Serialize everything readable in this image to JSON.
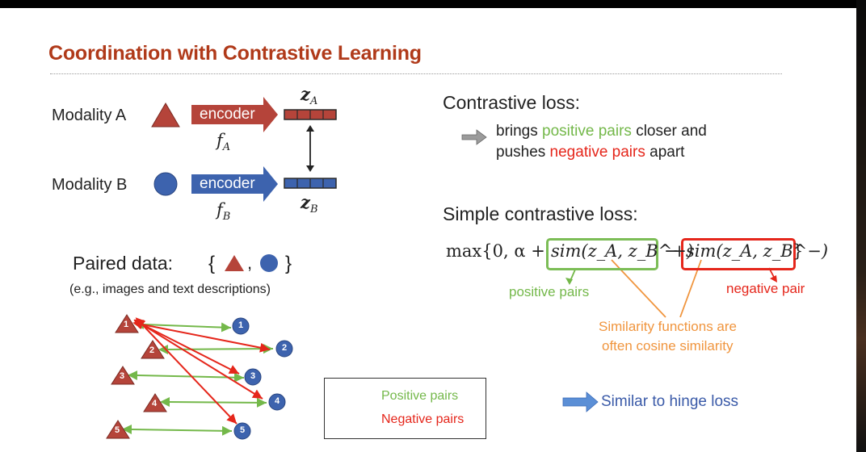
{
  "slide": {
    "title": "Coordination with Contrastive Learning",
    "modality_a": "Modality A",
    "modality_b": "Modality B",
    "encoder_label": "encoder",
    "f_a": "f",
    "f_a_sub": "A",
    "f_b": "f",
    "f_b_sub": "B",
    "z_a": "z",
    "z_a_sub": "A",
    "z_b": "z",
    "z_b_sub": "B",
    "paired_data_label": "Paired data:",
    "paired_open": "{",
    "paired_comma": ",",
    "paired_close": "}",
    "paired_example": "(e.g., images and text descriptions)",
    "triangle_numbers": [
      "1",
      "2",
      "3",
      "4",
      "5"
    ],
    "circle_numbers": [
      "1",
      "2",
      "3",
      "4",
      "5"
    ],
    "legend": {
      "positive": "Positive pairs",
      "negative": "Negative pairs"
    },
    "contrastive_heading": "Contrastive loss:",
    "line1_pre": "brings ",
    "line1_pos": "positive pairs",
    "line1_post": " closer and",
    "line2_pre": "pushes ",
    "line2_neg": "negative pairs",
    "line2_post": " apart",
    "simple_heading": "Simple contrastive loss:",
    "formula_start": "max{0, α + ",
    "formula_pos": "sim(z_A, z_B^+)",
    "formula_minus": "−",
    "formula_neg": "sim(z_A, z_B^−)",
    "formula_end": "}",
    "ann_positive": "positive pairs",
    "ann_negative": "negative pair",
    "ann_similarity_1": "Similarity functions are",
    "ann_similarity_2": "often cosine similarity",
    "hinge": "Similar to hinge loss"
  },
  "colors": {
    "title": "#b03a1a",
    "positive": "#74b84a",
    "negative": "#e5261b",
    "annotation": "#f0953e",
    "triangle": "#b5443a",
    "circle": "#3d63ae",
    "hinge_text": "#3a5aa8"
  },
  "icons": [
    "triangle-icon",
    "circle-icon",
    "encoder-arrow-icon",
    "embedding-vector-icon",
    "double-arrow-icon",
    "right-arrow-icon"
  ]
}
